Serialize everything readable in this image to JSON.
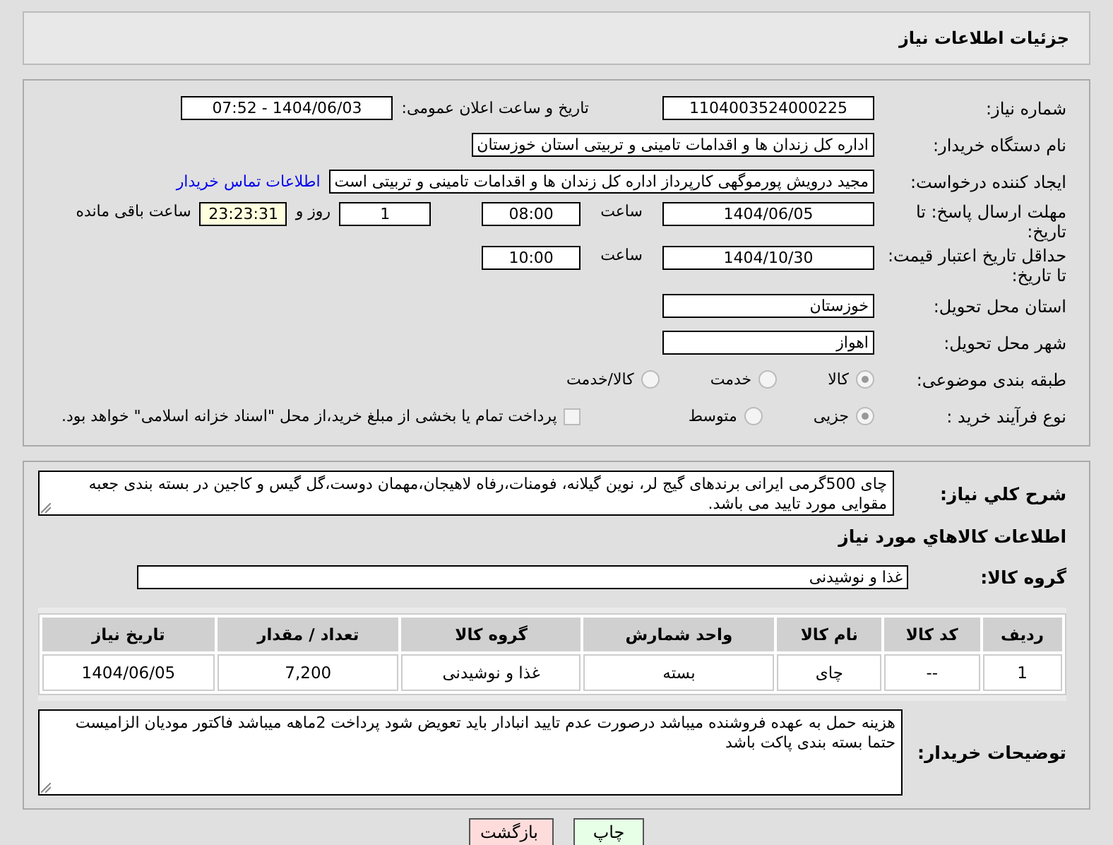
{
  "header": {
    "title": "جزئیات اطلاعات نیاز"
  },
  "need_number": {
    "label": "شماره نیاز:",
    "value": "1104003524000225"
  },
  "announce": {
    "label": "تاریخ و ساعت اعلان عمومی:",
    "value": "1404/06/03 - 07:52"
  },
  "buyer_org": {
    "label": "نام دستگاه خریدار:",
    "value": "اداره کل زندان ها و اقدامات تامینی و تربیتی استان خوزستان"
  },
  "requester": {
    "label": "ایجاد کننده درخواست:",
    "value": "مجید درویش پورموگهی کارپرداز اداره کل زندان ها و اقدامات تامینی و تربیتی است",
    "link": "اطلاعات تماس خریدار"
  },
  "response_deadline": {
    "label": "مهلت ارسال پاسخ: تا تاریخ:",
    "date": "1404/06/05",
    "time_label": "ساعت",
    "time": "08:00",
    "days": "1",
    "days_label": "روز و",
    "remaining": "23:23:31",
    "remaining_label": "ساعت باقی مانده"
  },
  "price_validity": {
    "label": "حداقل تاریخ اعتبار قیمت: تا تاریخ:",
    "date": "1404/10/30",
    "time_label": "ساعت",
    "time": "10:00"
  },
  "province": {
    "label": "استان محل تحویل:",
    "value": "خوزستان"
  },
  "city": {
    "label": "شهر محل تحویل:",
    "value": "اهواز"
  },
  "category": {
    "label": "طبقه بندی موضوعی:",
    "options": [
      {
        "label": "کالا",
        "selected": true
      },
      {
        "label": "خدمت",
        "selected": false
      },
      {
        "label": "کالا/خدمت",
        "selected": false
      }
    ]
  },
  "purchase_process": {
    "label": "نوع فرآیند خرید :",
    "options": [
      {
        "label": "جزیی",
        "selected": true
      },
      {
        "label": "متوسط",
        "selected": false
      }
    ],
    "payment": {
      "label": "پرداخت تمام یا بخشی از مبلغ خرید،از محل \"اسناد خزانه اسلامی\" خواهد بود.",
      "checked": false
    }
  },
  "description": {
    "label": "شرح كلي نياز:",
    "value": "چای 500گرمی ایرانی برندهای گیج لر، نوین گیلانه، فومنات،رفاه لاهیجان،مهمان دوست،گل گیس و کاجین در بسته بندی جعبه مقوایی مورد تایید می باشد."
  },
  "goods": {
    "title": "اطلاعات كالاهاي مورد نياز",
    "group": {
      "label": "گروه کالا:",
      "value": "غذا و نوشیدنی"
    },
    "columns": [
      "ردیف",
      "کد کالا",
      "نام کالا",
      "واحد شمارش",
      "گروه کالا",
      "تعداد / مقدار",
      "تاریخ نیاز"
    ],
    "rows": [
      [
        "1",
        "--",
        "چای",
        "بسته",
        "غذا و نوشیدنی",
        "7,200",
        "1404/06/05"
      ]
    ]
  },
  "buyer_notes": {
    "label": "توضیحات خریدار:",
    "value": "هزینه حمل به عهده فروشنده میباشد درصورت عدم تایید انبادار باید تعویض شود پرداخت 2ماهه میباشد فاکتور مودیان الزامیست حتما بسته بندی پاکت باشد"
  },
  "buttons": [
    {
      "label": "چاپ",
      "kind": "print"
    },
    {
      "label": "بازگشت",
      "kind": "back"
    }
  ]
}
